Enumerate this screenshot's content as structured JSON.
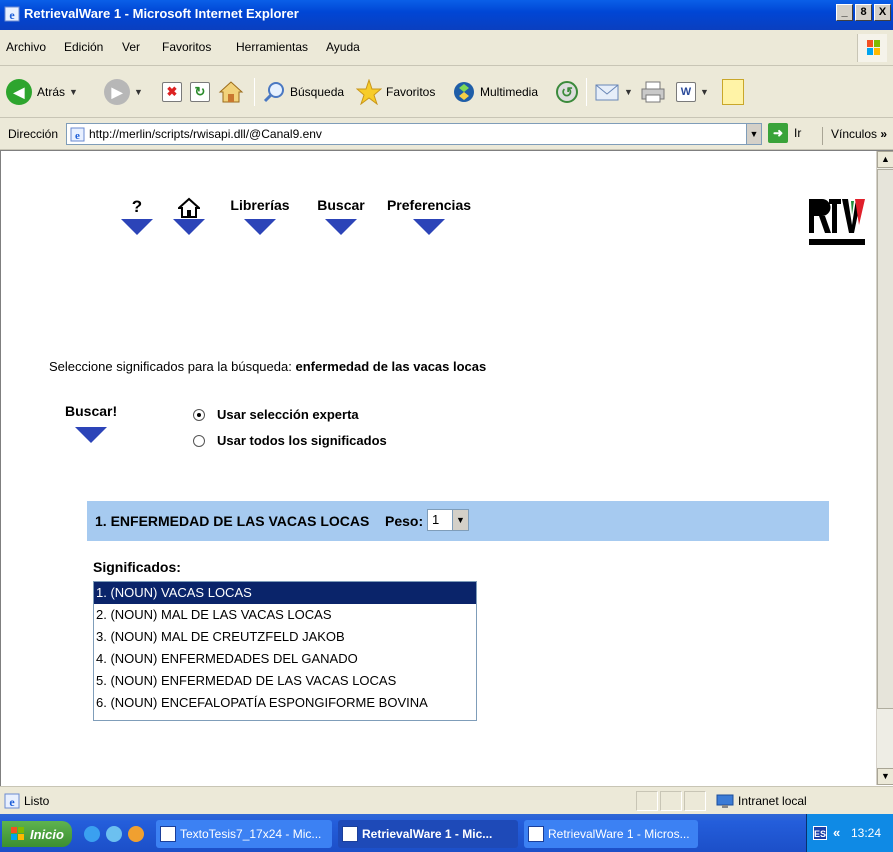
{
  "window": {
    "title": "RetrievalWare 1 - Microsoft Internet Explorer",
    "minimize": "_",
    "maximize": "8",
    "close": "X"
  },
  "menu": [
    "Archivo",
    "Edición",
    "Ver",
    "Favoritos",
    "Herramientas",
    "Ayuda"
  ],
  "toolbar": {
    "back": "Atrás",
    "search": "Búsqueda",
    "favorites": "Favoritos",
    "media": "Multimedia"
  },
  "address": {
    "label": "Dirección",
    "url": "http://merlin/scripts/rwisapi.dll/@Canal9.env",
    "go": "Ir",
    "links": "Vínculos"
  },
  "page": {
    "nav": {
      "help": "?",
      "libraries": "Librerías",
      "search": "Buscar",
      "preferences": "Preferencias"
    },
    "logo_text": "RTVV",
    "prompt_label": "Seleccione significados para la búsqueda:",
    "prompt_query": "enfermedad de las vacas locas",
    "buscar_label": "Buscar!",
    "options": {
      "expert": "Usar selección experta",
      "all": "Usar todos los significados",
      "selected": "expert"
    },
    "term": {
      "title": "1. ENFERMEDAD DE LAS VACAS LOCAS",
      "peso_label": "Peso:",
      "peso_value": "1"
    },
    "significados_label": "Significados:",
    "significados": [
      "1. (NOUN) VACAS LOCAS",
      "2. (NOUN) MAL DE LAS VACAS LOCAS",
      "3. (NOUN) MAL DE CREUTZFELD JAKOB",
      "4. (NOUN) ENFERMEDADES DEL GANADO",
      "5. (NOUN) ENFERMEDAD DE LAS VACAS LOCAS",
      "6. (NOUN) ENCEFALOPATÍA ESPONGIFORME BOVINA"
    ],
    "selected_index": 0
  },
  "status": {
    "text": "Listo",
    "zone": "Intranet local"
  },
  "taskbar": {
    "start": "Inicio",
    "tasks": [
      "TextoTesis7_17x24 - Mic...",
      "RetrievalWare 1 - Mic...",
      "RetrievalWare 1 - Micros..."
    ],
    "lang": "ES",
    "chevron": "«",
    "clock": "13:24"
  },
  "colors": {
    "band": "#a6caf0",
    "nav_arrow": "#2c44b8",
    "list_selected": "#0a246a"
  }
}
